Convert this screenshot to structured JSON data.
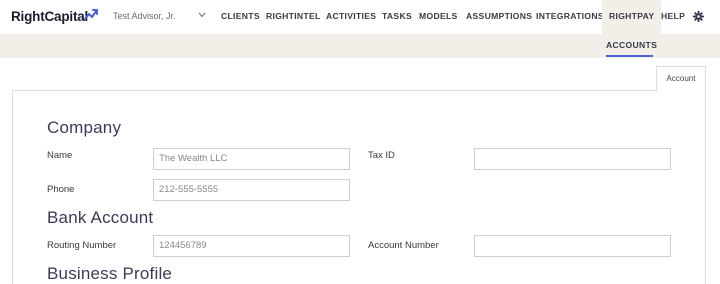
{
  "brand": {
    "name": "RightCapital",
    "accent": "#4a63d6"
  },
  "advisor": {
    "name": "Test Advisor, Jr."
  },
  "nav": {
    "items": [
      "CLIENTS",
      "RIGHTINTEL",
      "ACTIVITIES",
      "TASKS",
      "MODELS",
      "ASSUMPTIONS",
      "INTEGRATIONS",
      "RIGHTPAY",
      "HELP"
    ],
    "active": "RIGHTPAY",
    "settings_icon": "gear-icon"
  },
  "subnav": {
    "active_tab": "ACCOUNTS"
  },
  "content_tab": "Account",
  "sections": {
    "company": {
      "title": "Company",
      "name_label": "Name",
      "name_value": "The Wealth LLC",
      "tax_label": "Tax ID",
      "tax_value": "",
      "phone_label": "Phone",
      "phone_value": "212-555-5555"
    },
    "bank": {
      "title": "Bank Account",
      "routing_label": "Routing Number",
      "routing_value": "124456789",
      "account_label": "Account Number",
      "account_value": ""
    },
    "business": {
      "title": "Business Profile"
    }
  }
}
